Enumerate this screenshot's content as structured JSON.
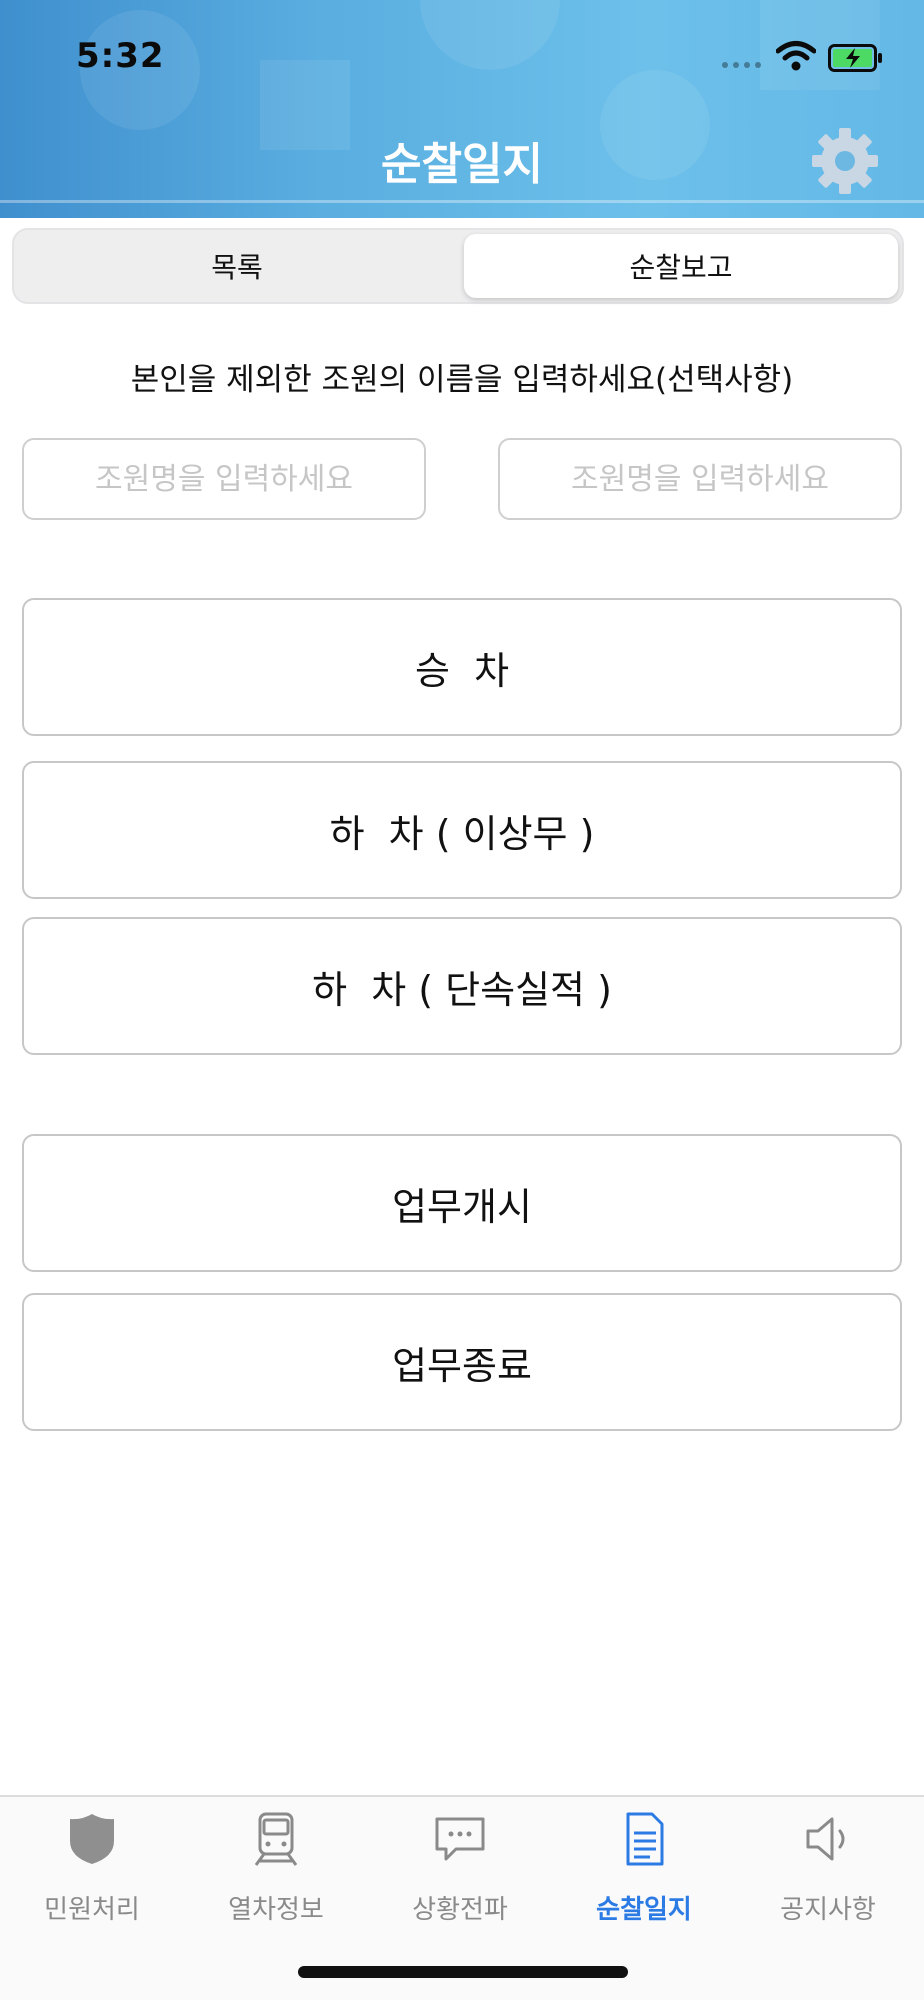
{
  "status_bar": {
    "time": "5:32"
  },
  "header": {
    "title": "순찰일지",
    "settings_icon": "gear-icon"
  },
  "segments": {
    "list_label": "목록",
    "report_label": "순찰보고",
    "selected": "순찰보고"
  },
  "form": {
    "instruction": "본인을 제외한 조원의 이름을 입력하세요(선택사항)",
    "member1": {
      "value": "",
      "placeholder": "조원명을 입력하세요"
    },
    "member2": {
      "value": "",
      "placeholder": "조원명을 입력하세요"
    }
  },
  "actions": {
    "board": "승  차",
    "alight_normal": "하  차 ( 이상무 )",
    "alight_enforcement": "하  차 ( 단속실적 )",
    "work_start": "업무개시",
    "work_end": "업무종료"
  },
  "tab_bar": {
    "items": [
      {
        "label": "민원처리",
        "icon": "shield-icon"
      },
      {
        "label": "열차정보",
        "icon": "train-icon"
      },
      {
        "label": "상황전파",
        "icon": "chat-bubble-icon"
      },
      {
        "label": "순찰일지",
        "icon": "document-icon",
        "active": true
      },
      {
        "label": "공지사항",
        "icon": "speaker-icon"
      }
    ],
    "active_color": "#2c7be5",
    "inactive_color": "#8a8a8a"
  }
}
